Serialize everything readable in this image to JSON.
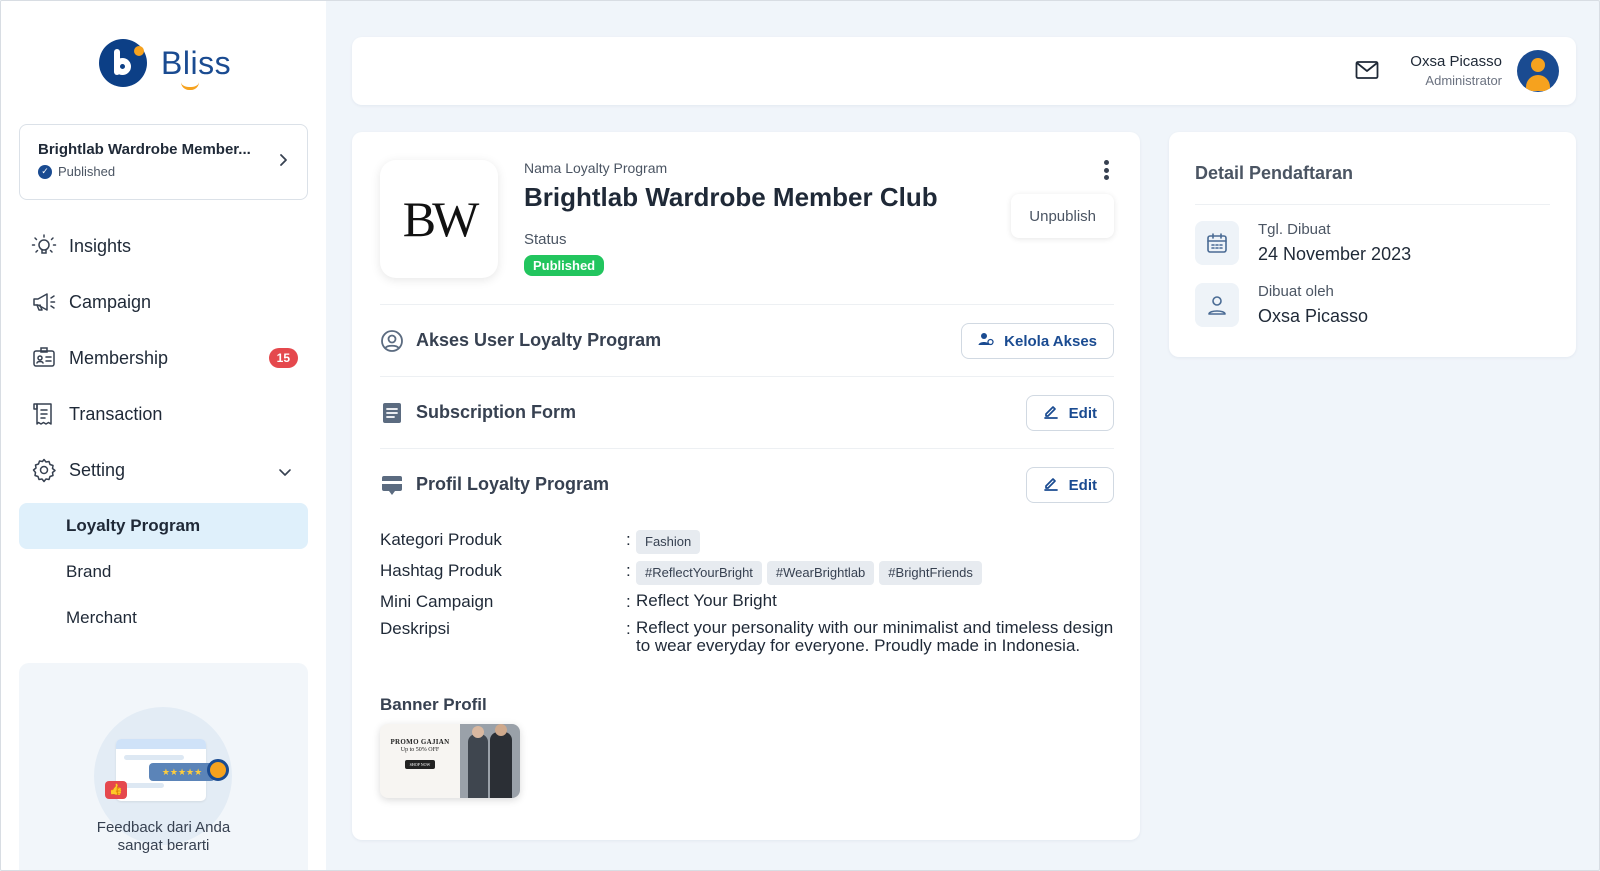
{
  "app": {
    "logo_text": "Bliss"
  },
  "sidebar": {
    "program": {
      "name": "Brightlab Wardrobe Member...",
      "status": "Published"
    },
    "items": [
      {
        "label": "Insights",
        "icon": "lightbulb-icon"
      },
      {
        "label": "Campaign",
        "icon": "megaphone-icon"
      },
      {
        "label": "Membership",
        "icon": "id-card-icon",
        "badge": "15"
      },
      {
        "label": "Transaction",
        "icon": "receipt-icon"
      },
      {
        "label": "Setting",
        "icon": "gear-icon"
      }
    ],
    "setting_sub": [
      {
        "label": "Loyalty Program",
        "active": true
      },
      {
        "label": "Brand",
        "active": false
      },
      {
        "label": "Merchant",
        "active": false
      }
    ],
    "feedback": {
      "text": "Feedback dari Anda sangat berarti"
    }
  },
  "header": {
    "user": {
      "name": "Oxsa Picasso",
      "role": "Administrator"
    }
  },
  "main": {
    "brand_logo_text": "BW",
    "program_label": "Nama Loyalty Program",
    "program_name": "Brightlab Wardrobe Member Club",
    "status_label": "Status",
    "status_value": "Published",
    "unpublish_label": "Unpublish",
    "sections": [
      {
        "title": "Akses User Loyalty Program",
        "button": "Kelola Akses",
        "icon": "user-circle-icon"
      },
      {
        "title": "Subscription Form",
        "button": "Edit",
        "icon": "form-icon"
      },
      {
        "title": "Profil Loyalty Program",
        "button": "Edit",
        "icon": "profile-card-icon"
      }
    ],
    "details": {
      "kategori_label": "Kategori Produk",
      "kategori_values": [
        "Fashion"
      ],
      "hashtag_label": "Hashtag Produk",
      "hashtag_values": [
        "#ReflectYourBright",
        "#WearBrightlab",
        "#BrightFriends"
      ],
      "mini_campaign_label": "Mini Campaign",
      "mini_campaign_value": "Reflect Your Bright",
      "deskripsi_label": "Deskripsi",
      "deskripsi_value": "Reflect your personality with our minimalist and timeless design to wear everyday for everyone. Proudly made in Indonesia.",
      "separator": ":"
    },
    "banner": {
      "label": "Banner Profil",
      "headline": "PROMO GAJIAN",
      "subline": "Up to 50% OFF",
      "cta": "SHOP NOW"
    }
  },
  "detail_pendaftaran": {
    "title": "Detail Pendaftaran",
    "created_label": "Tgl. Dibuat",
    "created_value": "24 November 2023",
    "created_by_label": "Dibuat oleh",
    "created_by_value": "Oxsa Picasso"
  },
  "colors": {
    "brand": "#1a4b91",
    "accent": "#f6a21e",
    "success": "#22c55e",
    "danger": "#e5484d",
    "active_bg": "#dff0fb"
  }
}
